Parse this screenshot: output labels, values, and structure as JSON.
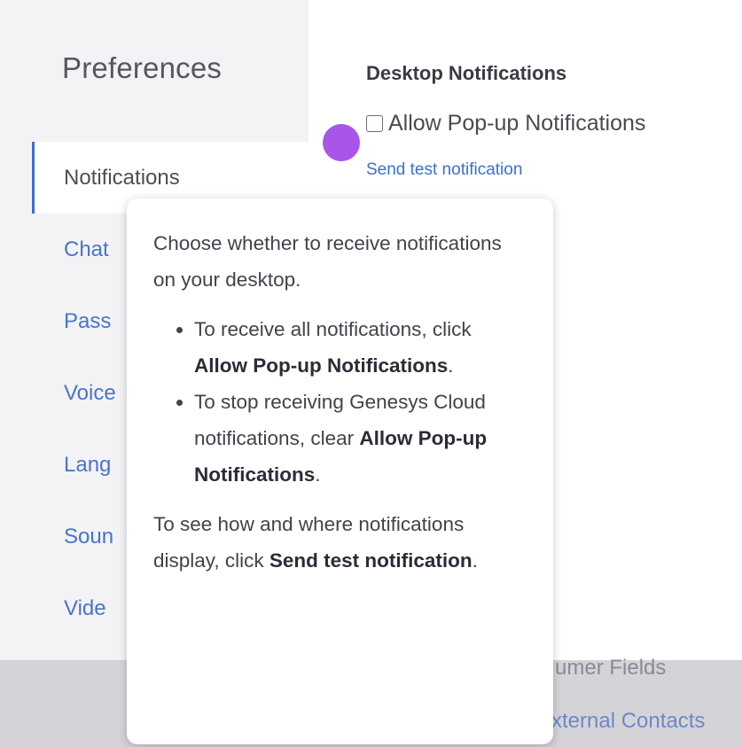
{
  "sidebar": {
    "title": "Preferences",
    "items": [
      {
        "label": "Notifications"
      },
      {
        "label": "Chat"
      },
      {
        "label": "Pass"
      },
      {
        "label": "Voice"
      },
      {
        "label": "Lang"
      },
      {
        "label": "Soun"
      },
      {
        "label": "Vide"
      }
    ]
  },
  "main": {
    "section_title": "Desktop Notifications",
    "checkbox_label": "Allow Pop-up Notifications",
    "checkbox_checked": false,
    "test_link": "Send test notification"
  },
  "background": {
    "text_1": "umer Fields",
    "text_2": "xternal Contacts"
  },
  "tooltip": {
    "intro": "Choose whether to receive notifications on your desktop.",
    "bullet_1_pre": "To receive all notifications, click ",
    "bullet_1_bold": "Allow Pop-up Notifications",
    "bullet_1_post": ".",
    "bullet_2_pre": "To stop receiving Genesys Cloud notifications, clear ",
    "bullet_2_bold": "Allow Pop-up Notifications",
    "bullet_2_post": ".",
    "outro_pre": "To see how and where notifications display, click ",
    "outro_bold": "Send test notification",
    "outro_post": "."
  },
  "colors": {
    "accent": "#3d6fcf",
    "marker": "#a855e8"
  }
}
